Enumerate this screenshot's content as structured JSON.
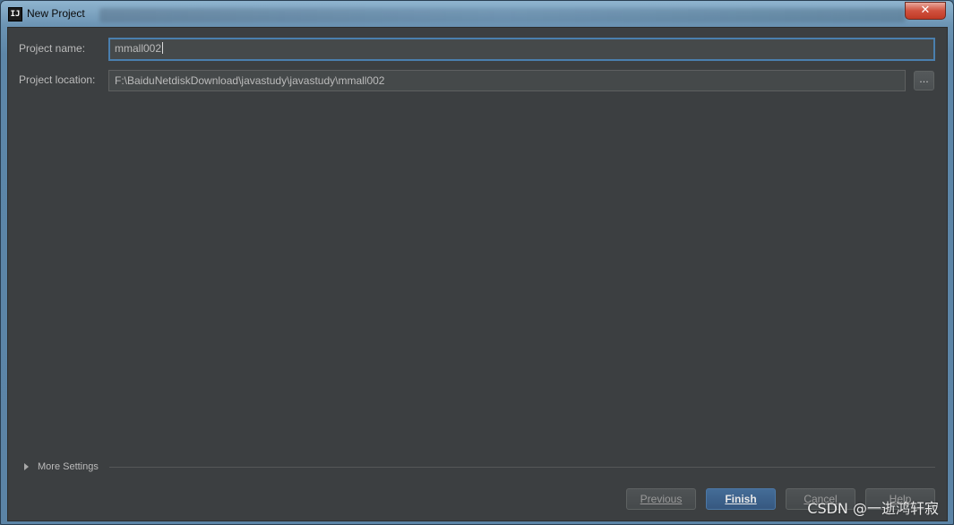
{
  "window": {
    "title": "New Project",
    "app_icon_text": "IJ",
    "close_glyph": "✕"
  },
  "form": {
    "project_name_label": "Project name:",
    "project_name_value": "mmall002",
    "project_location_label": "Project location:",
    "project_location_value": "F:\\BaiduNetdiskDownload\\javastudy\\javastudy\\mmall002",
    "browse_label": "..."
  },
  "more_settings": {
    "label": "More Settings",
    "icon": "triangle-right-icon"
  },
  "buttons": {
    "previous": "Previous",
    "finish": "Finish",
    "cancel": "Cancel",
    "help": "Help"
  },
  "watermark": "CSDN @一逝鸿轩寂",
  "colors": {
    "dialog_bg": "#3c3f41",
    "field_bg": "#45494a",
    "focus_border": "#4a7fae",
    "primary_button": "#365880"
  }
}
